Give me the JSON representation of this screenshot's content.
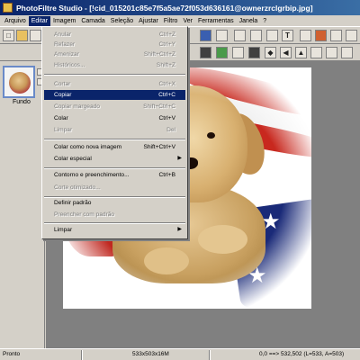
{
  "window": {
    "title": "PhotoFiltre Studio - [!cid_015201c85e7f5a5ae72f053d636161@ownerzrclgrbip.jpg]"
  },
  "menubar": {
    "items": [
      "Arquivo",
      "Editar",
      "Imagem",
      "Camada",
      "Seleção",
      "Ajustar",
      "Filtro",
      "Ver",
      "Ferramentas",
      "Janela",
      "?"
    ],
    "active": "Editar"
  },
  "edit_menu": {
    "items": [
      {
        "label": "Anular",
        "shortcut": "Ctrl+Z",
        "enabled": false
      },
      {
        "label": "Refazer",
        "shortcut": "Ctrl+Y",
        "enabled": false
      },
      {
        "label": "Amenizar",
        "shortcut": "Shift+Ctrl+Z",
        "enabled": false
      },
      {
        "label": "Históricos...",
        "shortcut": "Shift+Z",
        "enabled": false
      },
      {
        "label": "Cortar",
        "shortcut": "Ctrl+X",
        "enabled": false
      },
      {
        "label": "Copiar",
        "shortcut": "Ctrl+C",
        "enabled": true,
        "highlighted": true
      },
      {
        "label": "Copiar margeado",
        "shortcut": "Shift+Ctrl+C",
        "enabled": false
      },
      {
        "label": "Colar",
        "shortcut": "Ctrl+V",
        "enabled": true
      },
      {
        "label": "Limpar",
        "shortcut": "Del",
        "enabled": false
      },
      {
        "label": "Colar como nova imagem",
        "shortcut": "Shift+Ctrl+V",
        "enabled": true
      },
      {
        "label": "Colar especial",
        "shortcut": "",
        "enabled": true,
        "submenu": true
      },
      {
        "label": "Contorno e preenchimento...",
        "shortcut": "Ctrl+B",
        "enabled": true
      },
      {
        "label": "Corte otimizado...",
        "shortcut": "",
        "enabled": false
      },
      {
        "label": "Definir padrão",
        "shortcut": "",
        "enabled": true
      },
      {
        "label": "Preencher com padrão",
        "shortcut": "",
        "enabled": false
      },
      {
        "label": "Limpar",
        "shortcut": "",
        "enabled": true,
        "submenu": true
      }
    ]
  },
  "layers_panel": {
    "layer_name": "Fundo"
  },
  "statusbar": {
    "state": "Pronto",
    "dimensions": "533x503x16M",
    "coords": "0,0 ==> 532,502 (L=533, A=503)"
  },
  "colors": {
    "title_gradient_start": "#0a246a",
    "highlight": "#0a246a",
    "chrome": "#d4d0c8"
  }
}
